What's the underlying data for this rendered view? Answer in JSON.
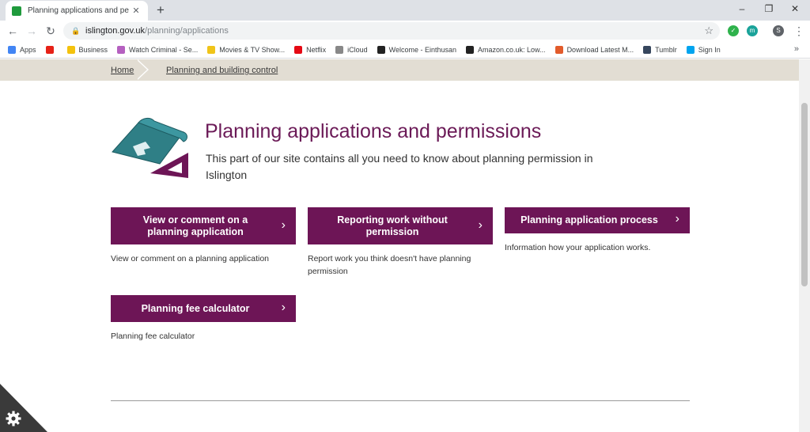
{
  "browser": {
    "tab_title": "Planning applications and perm",
    "new_tab": "+",
    "url_host": "islington.gov.uk",
    "url_path": "/planning/applications",
    "profile_initial": "S",
    "ext_initial": "m",
    "window_controls": {
      "minimize": "–",
      "restore": "❐",
      "close": "✕"
    },
    "nav": {
      "back": "←",
      "forward": "→",
      "reload": "↻"
    }
  },
  "bookmarks": [
    {
      "label": "Apps",
      "icon": "apps-grid-icon",
      "color": "#4285f4"
    },
    {
      "label": "",
      "icon": "youtube-icon",
      "color": "#e62117"
    },
    {
      "label": "Business",
      "icon": "folder-icon",
      "color": "#f4c20d"
    },
    {
      "label": "Watch Criminal - Se...",
      "icon": "play-icon",
      "color": "#b560c0"
    },
    {
      "label": "Movies & TV Show...",
      "icon": "play-circle-icon",
      "color": "#f0c419"
    },
    {
      "label": "Netflix",
      "icon": "netflix-icon",
      "color": "#e50914"
    },
    {
      "label": "iCloud",
      "icon": "apple-icon",
      "color": "#888888"
    },
    {
      "label": "Welcome - Einthusan",
      "icon": "einthusan-icon",
      "color": "#222222"
    },
    {
      "label": "Amazon.co.uk: Low...",
      "icon": "amazon-icon",
      "color": "#222222"
    },
    {
      "label": "Download Latest M...",
      "icon": "g-icon",
      "color": "#e25b2b"
    },
    {
      "label": "Tumblr",
      "icon": "tumblr-icon",
      "color": "#36465d"
    },
    {
      "label": "Sign In",
      "icon": "microsoft-icon",
      "color": "#00a4ef"
    }
  ],
  "bookmarks_more": "»",
  "breadcrumb": {
    "home": "Home",
    "section": "Planning and building control"
  },
  "page": {
    "title": "Planning applications and permissions",
    "intro": "This part of our site contains all you need to know about planning permission in Islington"
  },
  "cards": [
    {
      "label": "View or comment on a planning application",
      "desc": "View or comment on a planning application"
    },
    {
      "label": "Reporting work without permission",
      "desc": "Report work you think doesn't have planning permission"
    },
    {
      "label": "Planning application process",
      "desc": "Information how your application works."
    },
    {
      "label": "Planning fee calculator",
      "desc": "Planning fee calculator"
    }
  ],
  "chevron": "›",
  "colors": {
    "brand_purple": "#6d1556",
    "title_purple": "#6b1a57",
    "breadcrumb_bg": "#e2ddd3",
    "icon_teal": "#2f7f86"
  }
}
